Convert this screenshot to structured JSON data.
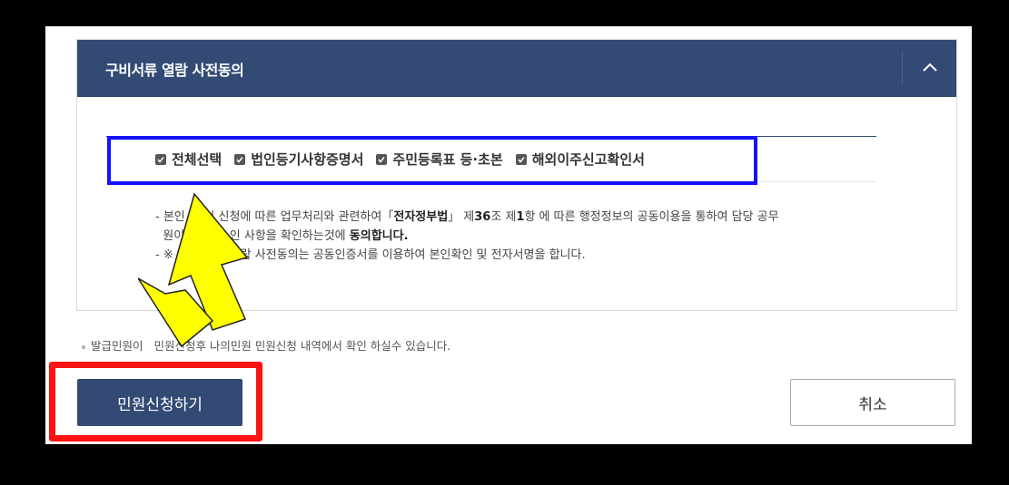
{
  "panel": {
    "title": "구비서류 열람 사전동의"
  },
  "checkboxes": [
    {
      "label": "전체선택",
      "checked": true
    },
    {
      "label": "법인등기사항증명서",
      "checked": true
    },
    {
      "label": "주민등록표 등·초본",
      "checked": true
    },
    {
      "label": "해외이주신고확인서",
      "checked": true
    }
  ],
  "notes": {
    "line1_a": "- 본인",
    "line1_b": "이 신청",
    "line1_c": "에 따른 업무처리와 관련하여「",
    "law": "전자정부법",
    "line1_d": "」 제",
    "article": "36",
    "line1_e": "조 제",
    "clause": "1",
    "line1_f": "항 에 따른 행정정보의 공동이용을 통하여 담당 공무",
    "line2_a": "원이",
    "line2_b": "인 사항을 확인하는것에 ",
    "agree": "동의합니다.",
    "line3_a": "- ※",
    "line3_b": "열람 사전동의는 공동인증서를 이용하여 본인확인 및 전자서명을 합니다."
  },
  "footnote": "발급민원이",
  "footnote_b": "민원신청후 나의민원 민원신청 내역에서 확인 하실수 있습니다.",
  "buttons": {
    "apply": "민원신청하기",
    "cancel": "취소"
  },
  "colors": {
    "header": "#324a74",
    "highlight_blue": "#1212ff",
    "highlight_red": "#ff1212",
    "arrow": "#ffff00"
  }
}
